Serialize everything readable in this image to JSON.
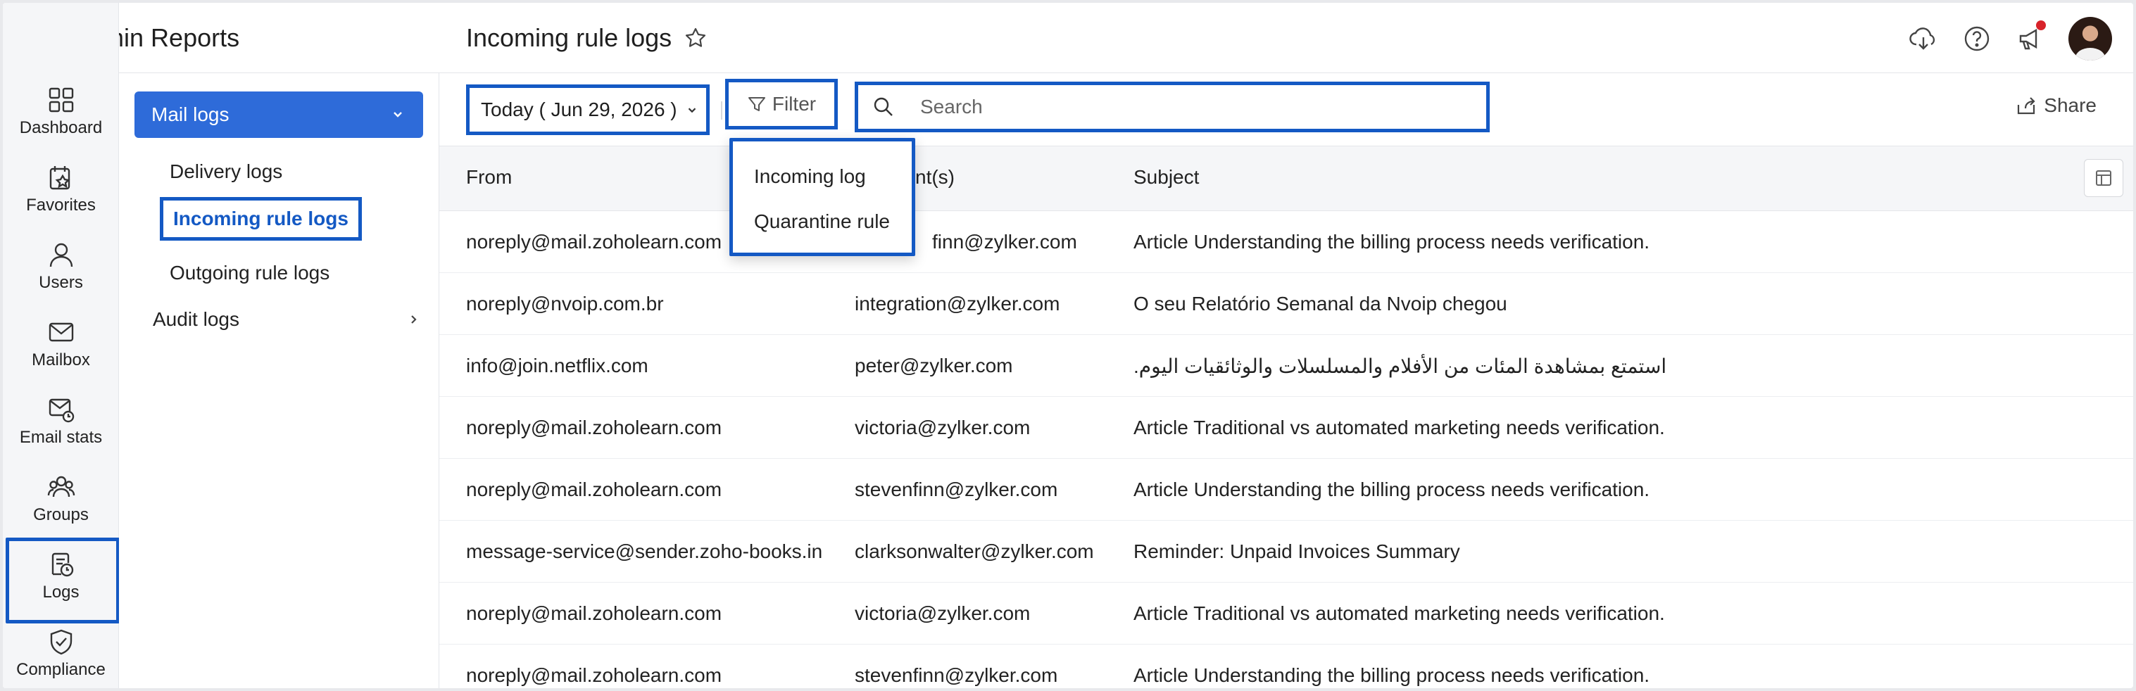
{
  "app": {
    "title": "Admin Reports"
  },
  "rail": [
    {
      "label": "Dashboard",
      "icon": "dashboard-icon"
    },
    {
      "label": "Favorites",
      "icon": "favorites-icon"
    },
    {
      "label": "Users",
      "icon": "user-icon"
    },
    {
      "label": "Mailbox",
      "icon": "mailbox-icon"
    },
    {
      "label": "Email stats",
      "icon": "email-stats-icon"
    },
    {
      "label": "Groups",
      "icon": "groups-icon"
    },
    {
      "label": "Logs",
      "icon": "logs-icon",
      "active": true
    },
    {
      "label": "Compliance",
      "icon": "compliance-icon"
    }
  ],
  "subnav": {
    "section": "Mail logs",
    "items": [
      "Delivery logs",
      "Incoming rule logs",
      "Outgoing rule logs"
    ],
    "active": "Incoming rule logs",
    "audit": "Audit logs"
  },
  "header": {
    "title": "Incoming rule logs"
  },
  "toolbar": {
    "date": "Today ( Jun 29, 2026 )",
    "filter": "Filter",
    "search_placeholder": "Search",
    "share": "Share"
  },
  "dropdown": {
    "options": [
      "Incoming log",
      "Quarantine rule"
    ]
  },
  "table": {
    "columns": [
      "From",
      "Recipient(s)",
      "Subject"
    ],
    "columns_visible": [
      "From",
      "nt(s)",
      "Subject"
    ],
    "rows": [
      {
        "from": "noreply@mail.zoholearn.com",
        "to": "stevenfinn@zylker.com",
        "to_visible": "finn@zylker.com",
        "subject": "Article Understanding the billing process needs verification."
      },
      {
        "from": "noreply@nvoip.com.br",
        "to": "integration@zylker.com",
        "subject": "O seu Relatório Semanal da Nvoip chegou"
      },
      {
        "from": "info@join.netflix.com",
        "to": "peter@zylker.com",
        "subject": "استمتع بمشاهدة المئات من الأفلام والمسلسلات والوثائقيات اليوم."
      },
      {
        "from": "noreply@mail.zoholearn.com",
        "to": "victoria@zylker.com",
        "subject": "Article Traditional vs automated marketing needs verification."
      },
      {
        "from": "noreply@mail.zoholearn.com",
        "to": "stevenfinn@zylker.com",
        "subject": "Article Understanding the billing process needs verification."
      },
      {
        "from": "message-service@sender.zoho-books.in",
        "to": "clarksonwalter@zylker.com",
        "subject": "Reminder: Unpaid Invoices Summary"
      },
      {
        "from": "noreply@mail.zoholearn.com",
        "to": "victoria@zylker.com",
        "subject": "Article Traditional vs automated marketing needs verification."
      },
      {
        "from": "noreply@mail.zoholearn.com",
        "to": "stevenfinn@zylker.com",
        "subject": "Article Understanding the billing process needs verification."
      }
    ]
  },
  "colors": {
    "accent": "#2e6bd9",
    "highlight_border": "#1459c4",
    "notification": "#d8232a"
  }
}
